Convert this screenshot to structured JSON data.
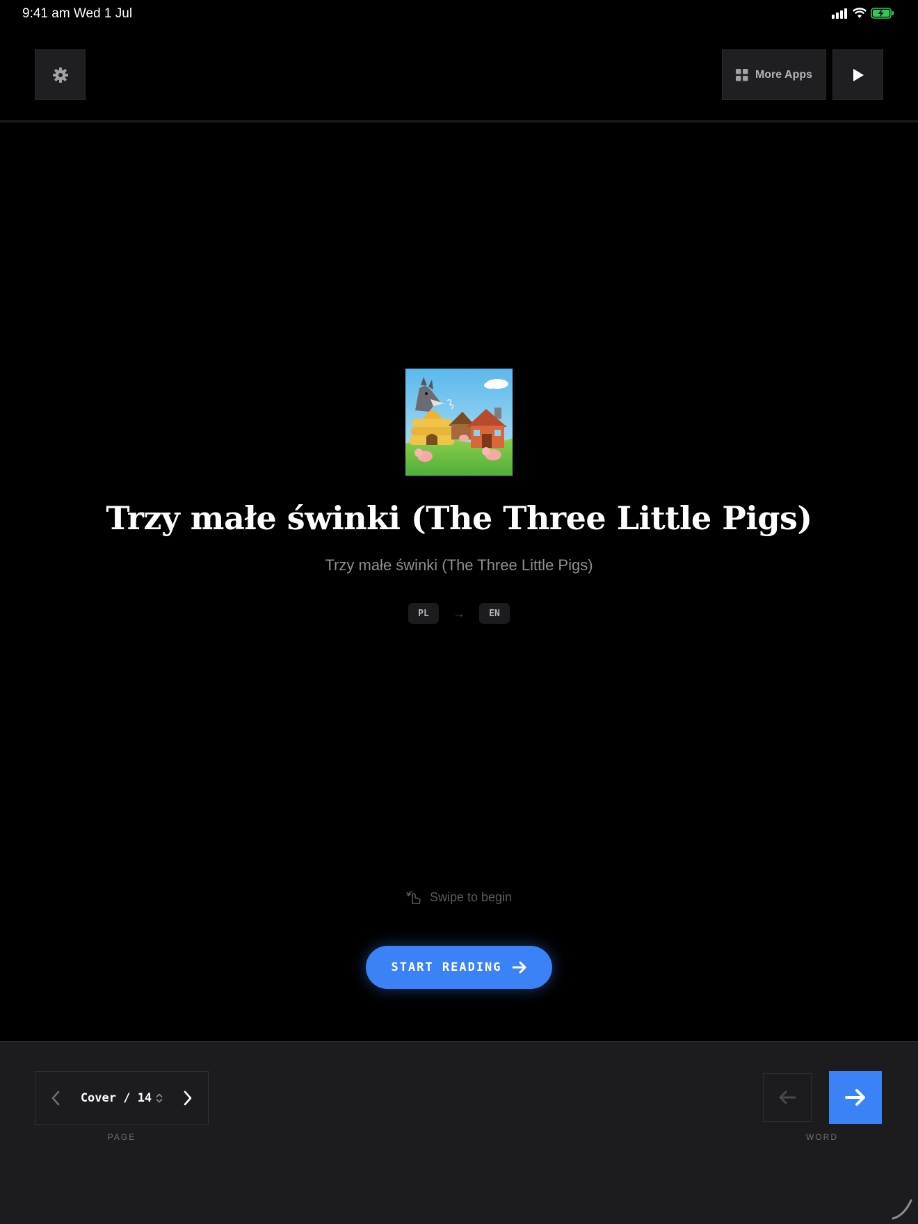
{
  "status_bar": {
    "time": "9:41 am   Wed 1 Jul",
    "battery_color": "#34c759"
  },
  "top_bar": {
    "more_apps_label": "More Apps"
  },
  "cover": {
    "title": "Trzy małe świnki (The Three Little Pigs)",
    "subtitle": "Trzy małe świnki (The Three Little Pigs)",
    "source_lang": "PL",
    "target_lang": "EN",
    "lang_arrow": "→",
    "swipe_hint": "Swipe to begin",
    "start_label": "START READING"
  },
  "bottom_bar": {
    "page_current": "Cover / 14",
    "page_caption": "PAGE",
    "word_caption": "WORD"
  },
  "colors": {
    "accent": "#3b82f6",
    "background": "#000000",
    "panel": "#1c1c1e"
  },
  "icons": {
    "settings": "gear-icon",
    "more_apps": "grid-icon",
    "play": "play-icon",
    "swipe": "hand-swipe-icon",
    "start": "arrow-right-icon",
    "page_prev": "chevron-left-icon",
    "page_next": "chevron-right-icon",
    "page_picker": "up-down-chevron-icon",
    "word_prev": "arrow-left-icon",
    "word_next": "arrow-right-icon"
  }
}
